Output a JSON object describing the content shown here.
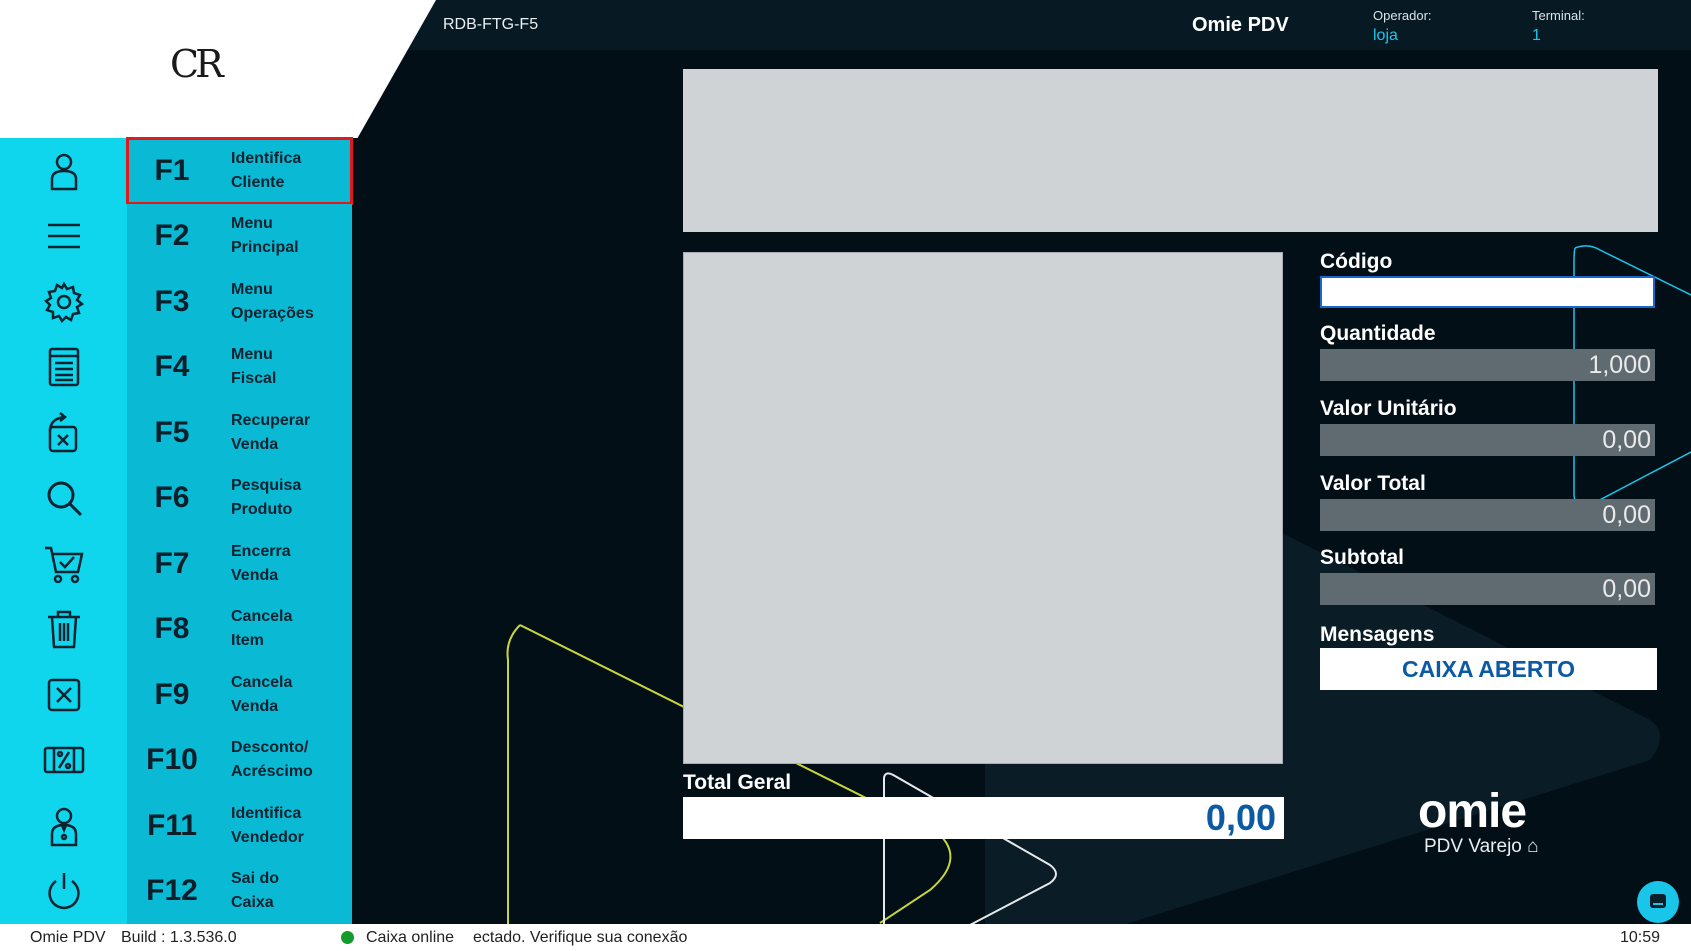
{
  "header": {
    "doc_id": "RDB-FTG-F5",
    "app_name": "Omie PDV",
    "operator_label": "Operador:",
    "operator_value": "loja",
    "terminal_label": "Terminal:",
    "terminal_value": "1"
  },
  "logo": {
    "text": "CR"
  },
  "function_keys": [
    {
      "key": "F1",
      "line1": "Identifica",
      "line2": "Cliente",
      "icon": "person-icon"
    },
    {
      "key": "F2",
      "line1": "Menu",
      "line2": "Principal",
      "icon": "menu-icon"
    },
    {
      "key": "F3",
      "line1": "Menu",
      "line2": "Operações",
      "icon": "gear-icon"
    },
    {
      "key": "F4",
      "line1": "Menu",
      "line2": "Fiscal",
      "icon": "receipt-icon"
    },
    {
      "key": "F5",
      "line1": "Recuperar",
      "line2": "Venda",
      "icon": "recover-icon"
    },
    {
      "key": "F6",
      "line1": "Pesquisa",
      "line2": "Produto",
      "icon": "search-icon"
    },
    {
      "key": "F7",
      "line1": "Encerra",
      "line2": "Venda",
      "icon": "cart-check-icon"
    },
    {
      "key": "F8",
      "line1": "Cancela",
      "line2": "Item",
      "icon": "trash-icon"
    },
    {
      "key": "F9",
      "line1": "Cancela",
      "line2": "Venda",
      "icon": "close-box-icon"
    },
    {
      "key": "F10",
      "line1": "Desconto/",
      "line2": "Acréscimo",
      "icon": "percent-ticket-icon"
    },
    {
      "key": "F11",
      "line1": "Identifica",
      "line2": "Vendedor",
      "icon": "seller-icon"
    },
    {
      "key": "F12",
      "line1": "Sai do",
      "line2": "Caixa",
      "icon": "power-icon"
    }
  ],
  "form": {
    "codigo_label": "Código",
    "codigo_value": "",
    "quantidade_label": "Quantidade",
    "quantidade_value": "1,000",
    "valor_unitario_label": "Valor Unitário",
    "valor_unitario_value": "0,00",
    "valor_total_label": "Valor Total",
    "valor_total_value": "0,00",
    "subtotal_label": "Subtotal",
    "subtotal_value": "0,00",
    "mensagens_label": "Mensagens",
    "mensagem_value": "CAIXA ABERTO"
  },
  "totals": {
    "label": "Total Geral",
    "value": "0,00"
  },
  "brand": {
    "name": "omie",
    "subtitle": "PDV Varejo"
  },
  "status": {
    "app": "Omie PDV",
    "build": "Build : 1.3.536.0",
    "connection": "Caixa online",
    "message": "ectado. Verifique sua conexão",
    "time": "10:59"
  },
  "colors": {
    "background": "#030f17",
    "sidebar_icon_bg": "#0fd6ec",
    "sidebar_key_bg": "#0ab9d3",
    "accent": "#19c6ea",
    "total_value": "#0b5aa3",
    "selection": "#e01a1a"
  }
}
